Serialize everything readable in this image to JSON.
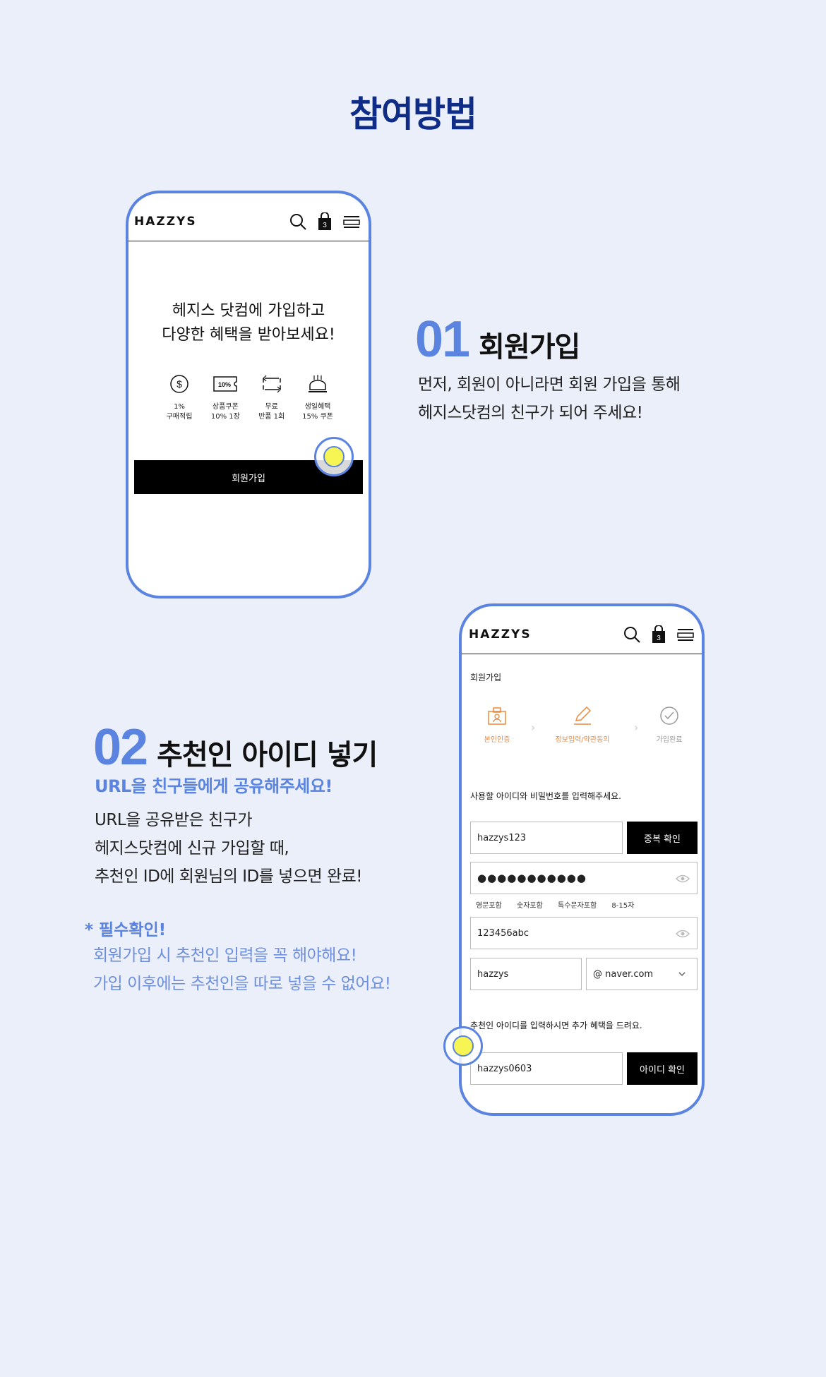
{
  "page_title": "참여방법",
  "brand": "HAZZYS",
  "phone1": {
    "cart_count": "3",
    "headline_line1": "헤지스 닷컴에 가입하고",
    "headline_line2": "다양한 혜택을 받아보세요!",
    "benefits": [
      {
        "icon": "dollar-coin-icon",
        "line1": "1%",
        "line2": "구매적립"
      },
      {
        "icon": "coupon-ticket-icon",
        "icon_text": "10%",
        "line1": "상품쿠폰",
        "line2": "10% 1장"
      },
      {
        "icon": "return-box-icon",
        "line1": "무료",
        "line2": "반품 1회"
      },
      {
        "icon": "birthday-cake-icon",
        "line1": "생일혜택",
        "line2": "15% 쿠폰"
      }
    ],
    "join_button": "회원가입"
  },
  "step1": {
    "number": "01",
    "title": "회원가입",
    "desc_line1": "먼저, 회원이 아니라면 회원 가입을 통해",
    "desc_line2": "헤지스닷컴의 친구가 되어 주세요!"
  },
  "step2": {
    "number": "02",
    "title": "추천인 아이디 넣기",
    "subtitle": "URL을 친구들에게 공유해주세요!",
    "desc_line1": "URL을 공유받은 친구가",
    "desc_line2": "헤지스닷컴에 신규 가입할 때,",
    "desc_line3": "추천인 ID에 회원님의 ID를 넣으면 완료!"
  },
  "required": {
    "title": "* 필수확인!",
    "line1": "회원가입 시 추천인 입력을 꼭 해야해요!",
    "line2": "가입 이후에는 추천인을 따로 넣을 수 없어요!"
  },
  "phone2": {
    "cart_count": "3",
    "page_label": "회원가입",
    "steps": [
      {
        "label": "본인인증",
        "active": true
      },
      {
        "label": "정보입력/약관동의",
        "active": true
      },
      {
        "label": "가입완료",
        "active": false
      }
    ],
    "instruction": "사용할 아이디와 비밀번호를 입력해주세요.",
    "id_value": "hazzys123",
    "dup_check_button": "중복 확인",
    "password_masked": "●●●●●●●●●●●",
    "password_rules": [
      "영문포함",
      "숫자포함",
      "특수문자포함",
      "8-15자"
    ],
    "password_confirm_value": "123456abc",
    "email_local": "hazzys",
    "email_domain": "@ naver.com",
    "recommend_text": "추천인 아이디를 입력하시면 추가 혜택을 드려요.",
    "recommend_value": "hazzys0603",
    "id_check_button": "아이디 확인"
  },
  "colors": {
    "background": "#ebeff9",
    "title_navy": "#0f2d86",
    "accent_blue": "#5a84e0",
    "step_orange": "#e9893c",
    "tap_yellow": "#f7f553"
  }
}
